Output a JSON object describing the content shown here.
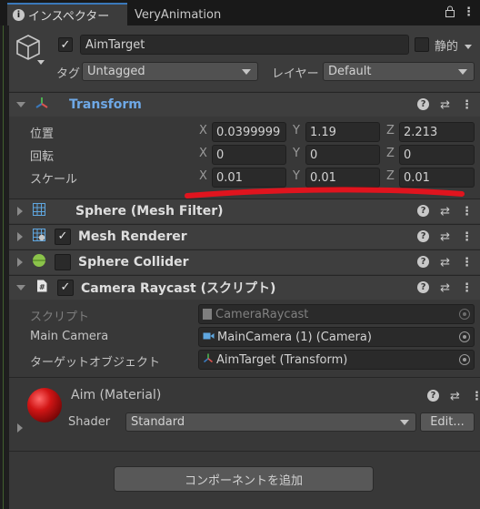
{
  "tabs": {
    "inspector": "インスペクター",
    "very_animation": "VeryAnimation"
  },
  "object": {
    "name": "AimTarget",
    "static_label": "静的",
    "tag_label": "タグ",
    "tag_value": "Untagged",
    "layer_label": "レイヤー",
    "layer_value": "Default"
  },
  "transform": {
    "title": "Transform",
    "position_label": "位置",
    "rotation_label": "回転",
    "scale_label": "スケール",
    "axis_x": "X",
    "axis_y": "Y",
    "axis_z": "Z",
    "position": {
      "x": "0.0399999",
      "y": "1.19",
      "z": "2.213"
    },
    "rotation": {
      "x": "0",
      "y": "0",
      "z": "0"
    },
    "scale": {
      "x": "0.01",
      "y": "0.01",
      "z": "0.01"
    }
  },
  "components": {
    "mesh_filter": "Sphere (Mesh Filter)",
    "mesh_renderer": "Mesh Renderer",
    "sphere_collider": "Sphere Collider",
    "camera_raycast": "Camera Raycast (スクリプト)"
  },
  "camera_raycast": {
    "script_label": "スクリプト",
    "script_value": "CameraRaycast",
    "main_camera_label": "Main Camera",
    "main_camera_value": "MainCamera (1) (Camera)",
    "target_label": "ターゲットオブジェクト",
    "target_value": "AimTarget (Transform)"
  },
  "material": {
    "title": "Aim (Material)",
    "shader_label": "Shader",
    "shader_value": "Standard",
    "edit_label": "Edit..."
  },
  "add_component_label": "コンポーネントを追加",
  "colors": {
    "accent_blue": "#3a79bb",
    "annotation_red": "#e0141e"
  }
}
